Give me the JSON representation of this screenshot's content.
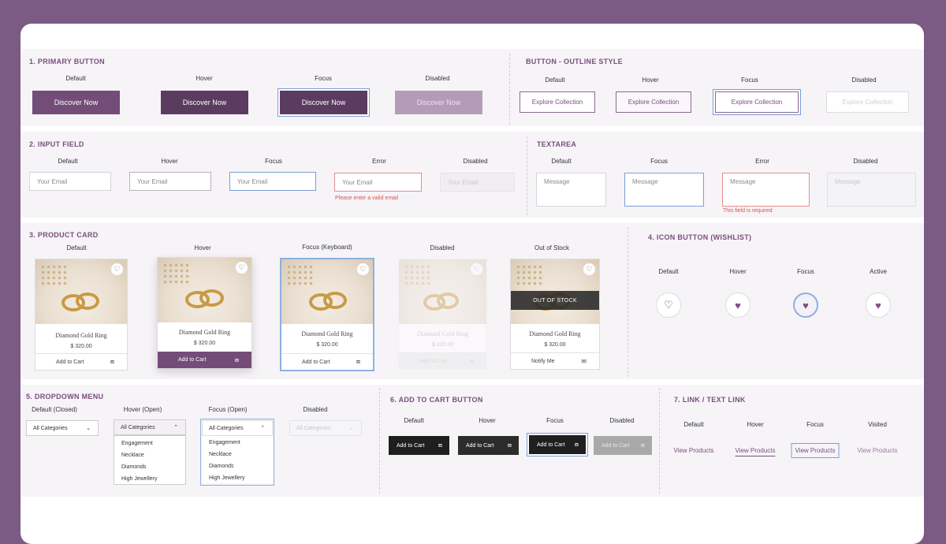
{
  "primary_button": {
    "title": "1. PRIMARY BUTTON",
    "states": [
      "Default",
      "Hover",
      "Focus",
      "Disabled"
    ],
    "label": "Discover Now"
  },
  "outline_button": {
    "title": "BUTTON - OUTLINE STYLE",
    "states": [
      "Default",
      "Hover",
      "Focus",
      "Disabled"
    ],
    "label": "Explore Collection"
  },
  "input_field": {
    "title": "2. INPUT FIELD",
    "states": [
      "Default",
      "Hover",
      "Focus",
      "Error",
      "Disabled"
    ],
    "placeholder": "Your Email",
    "error_text": "Please enter a valid email"
  },
  "textarea": {
    "title": "TEXTAREA",
    "states": [
      "Default",
      "Focus",
      "Error",
      "Disabled"
    ],
    "placeholder": "Message",
    "error_text": "This field is required"
  },
  "product_card": {
    "title": "3. PRODUCT CARD",
    "states": [
      "Default",
      "Hover",
      "Focus (Keyboard)",
      "Disabled",
      "Out of Stock"
    ],
    "name": "Diamond Gold Ring",
    "price": "$ 320.00",
    "cta": "Add to Cart",
    "notify": "Notify Me",
    "out_of_stock": "OUT OF STOCK"
  },
  "icon_button": {
    "title": "4. ICON BUTTON (WISHLIST)",
    "states": [
      "Default",
      "Hover",
      "Focus",
      "Active"
    ]
  },
  "dropdown": {
    "title": "5. DROPDOWN MENU",
    "states": [
      "Default (Closed)",
      "Hover (Open)",
      "Focus (Open)",
      "Disabled"
    ],
    "selected": "All Categories",
    "options": [
      "Engagement",
      "Necklace",
      "Diamonds",
      "High Jewellery"
    ]
  },
  "add_to_cart": {
    "title": "6. ADD TO CART BUTTON",
    "states": [
      "Default",
      "Hover",
      "Focus",
      "Disabled"
    ],
    "label": "Add to Cart"
  },
  "link": {
    "title": "7. LINK / TEXT LINK",
    "states": [
      "Default",
      "Hover",
      "Focus",
      "Visited"
    ],
    "label": "View Products"
  },
  "colors": {
    "brand": "#734c78",
    "error": "#d9534f",
    "focus": "#7b9fd8",
    "dark": "#1f1f1f"
  }
}
